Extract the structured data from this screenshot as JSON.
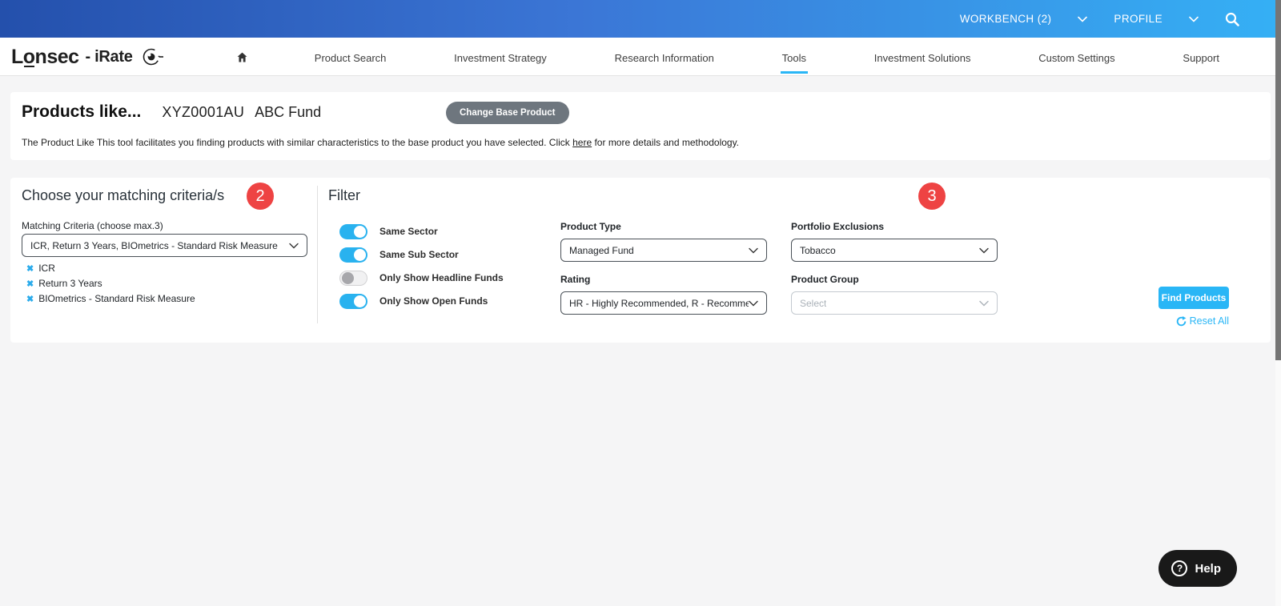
{
  "topbar": {
    "workbench": "WORKBENCH (2)",
    "profile": "PROFILE"
  },
  "brand": {
    "name": "Lonsec",
    "suffix": "- iRate"
  },
  "nav": {
    "items": [
      {
        "label": "Product Search"
      },
      {
        "label": "Investment Strategy"
      },
      {
        "label": "Research Information"
      },
      {
        "label": "Tools",
        "active": true
      },
      {
        "label": "Investment Solutions"
      },
      {
        "label": "Custom Settings"
      },
      {
        "label": "Support"
      }
    ]
  },
  "header": {
    "title": "Products like...",
    "product_code": "XYZ0001AU",
    "product_name": "ABC Fund",
    "change_button": "Change Base Product",
    "description_before": "The Product Like This tool facilitates you finding products with similar characteristics to the base product you have selected. Click ",
    "description_link": "here",
    "description_after": " for more details and methodology."
  },
  "criteria": {
    "title": "Choose your matching criteria/s",
    "badge": "2",
    "label": "Matching Criteria (choose max.3)",
    "selected": "ICR, Return 3 Years, BIOmetrics - Standard Risk Measure",
    "tags": [
      {
        "label": "ICR"
      },
      {
        "label": "Return 3 Years"
      },
      {
        "label": "BIOmetrics - Standard Risk Measure"
      }
    ]
  },
  "filter": {
    "title": "Filter",
    "badge": "3",
    "toggles": [
      {
        "label": "Same Sector",
        "on": true
      },
      {
        "label": "Same Sub Sector",
        "on": true
      },
      {
        "label": "Only Show Headline Funds",
        "on": false
      },
      {
        "label": "Only Show Open Funds",
        "on": true
      }
    ],
    "product_type": {
      "label": "Product Type",
      "value": "Managed Fund"
    },
    "rating": {
      "label": "Rating",
      "value": "HR - Highly Recommended, R - Recommended"
    },
    "portfolio_exclusions": {
      "label": "Portfolio Exclusions",
      "value": "Tobacco"
    },
    "product_group": {
      "label": "Product Group",
      "placeholder": "Select"
    },
    "find_button": "Find Products",
    "reset_label": "Reset All"
  },
  "help": {
    "label": "Help"
  },
  "icons": {
    "close": "✖",
    "question": "?"
  },
  "colors": {
    "accent": "#29b6f6",
    "badge_red": "#ee4343",
    "topbar_start": "#2450ac",
    "topbar_end": "#35b0f5",
    "gray_button": "#6e767e"
  }
}
